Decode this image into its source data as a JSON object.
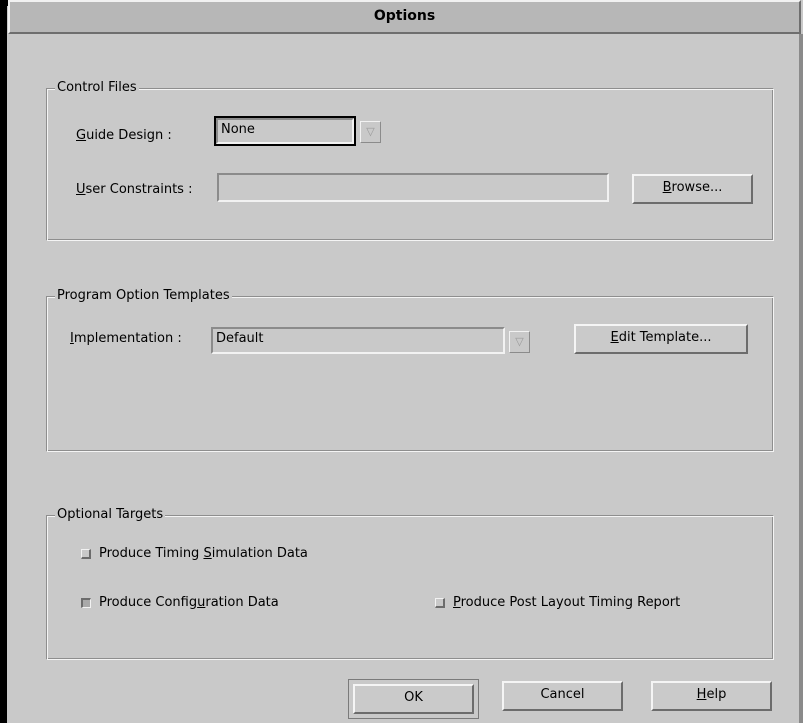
{
  "window": {
    "title": "Options"
  },
  "control_files": {
    "legend": "Control Files",
    "guide_design": {
      "label_pre": "",
      "label_ul": "G",
      "label_post": "uide Design :",
      "value": "None"
    },
    "user_constraints": {
      "label_pre": "",
      "label_ul": "U",
      "label_post": "ser Constraints :",
      "value": ""
    },
    "browse_button": {
      "pre": "",
      "ul": "B",
      "post": "rowse..."
    }
  },
  "program_option_templates": {
    "legend": "Program Option Templates",
    "implementation": {
      "label_pre": "",
      "label_ul": "I",
      "label_post": "mplementation :",
      "value": "Default"
    },
    "edit_template_button": {
      "pre": "",
      "ul": "E",
      "post": "dit Template..."
    }
  },
  "optional_targets": {
    "legend": "Optional Targets",
    "timing_simulation": {
      "pre": "Produce Timing ",
      "ul": "S",
      "post": "imulation Data",
      "checked": false
    },
    "configuration_data": {
      "pre": "Produce Config",
      "ul": "u",
      "post": "ration Data",
      "checked": true
    },
    "post_layout_timing": {
      "pre": "",
      "ul": "P",
      "post": "roduce Post Layout Timing Report",
      "checked": false
    }
  },
  "footer": {
    "ok": "OK",
    "cancel": "Cancel",
    "help": {
      "pre": "",
      "ul": "H",
      "post": "elp"
    }
  },
  "icons": {
    "dropdown": "chevron-down-icon"
  }
}
